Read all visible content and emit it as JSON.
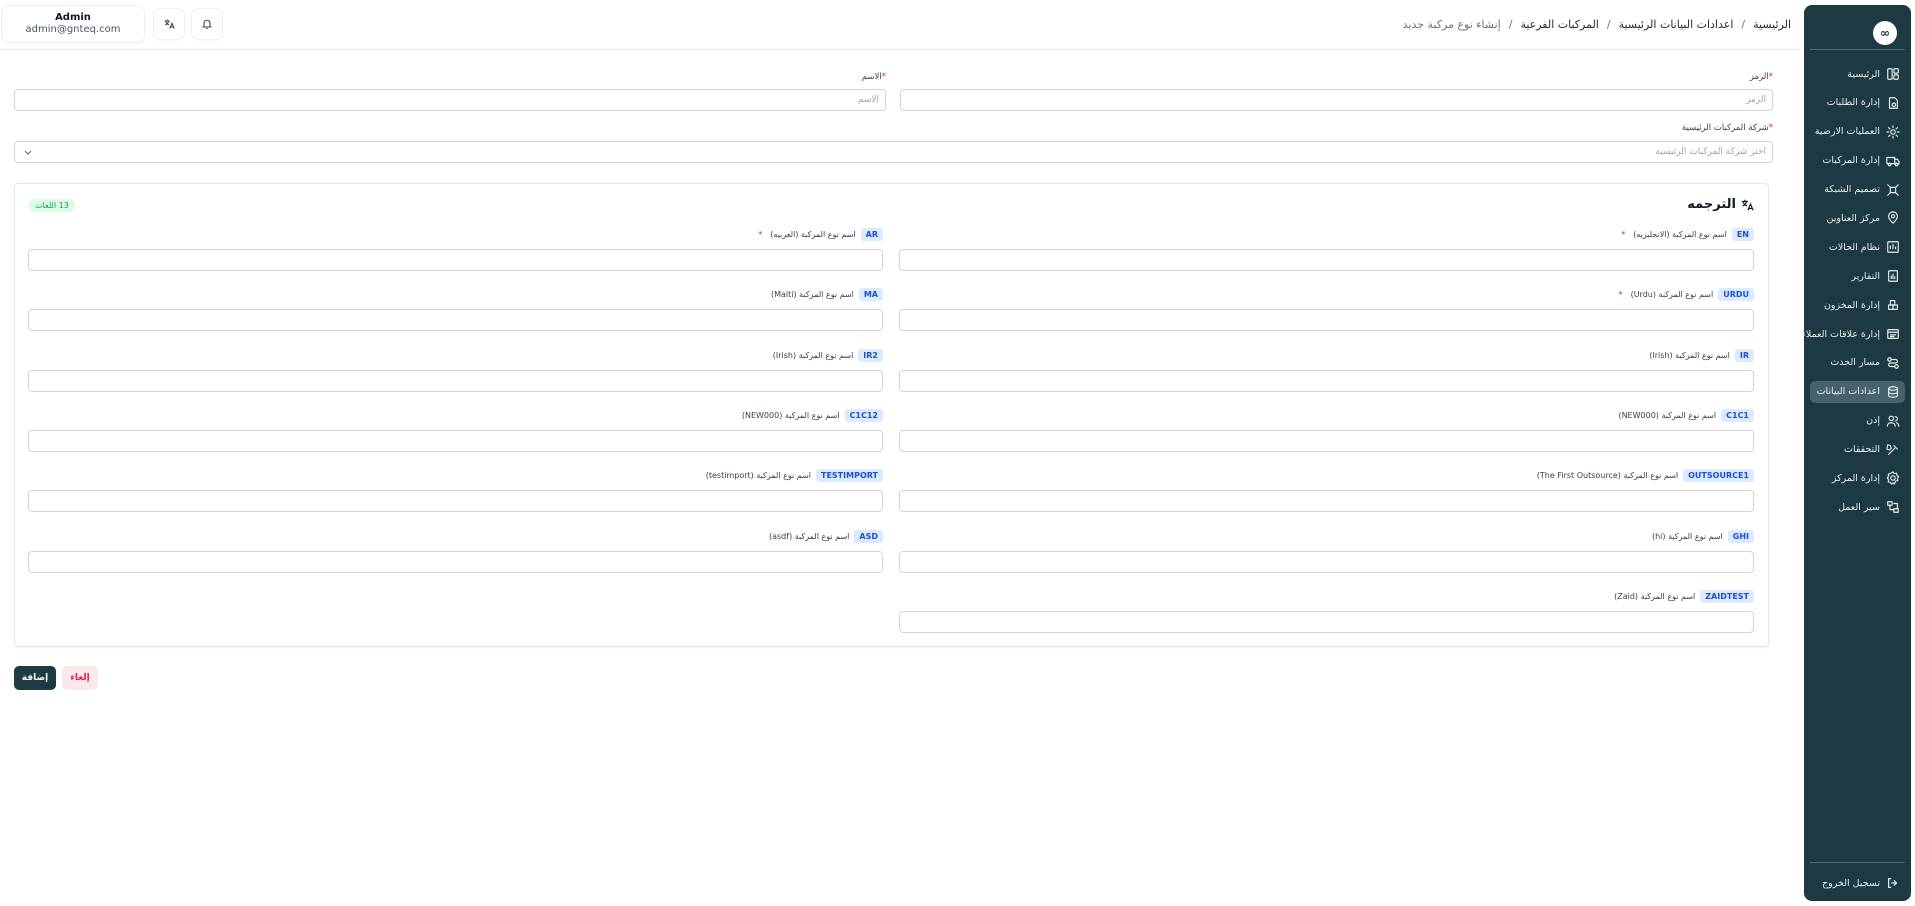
{
  "breadcrumb": [
    "الرئيسية",
    "اعدادات البيانات الرئيسية",
    "المركبات الفرعية"
  ],
  "breadcrumb_current": "إنشاء نوع مركبة جديد",
  "user": {
    "name": "Admin",
    "email": "admin@gnteq.com"
  },
  "header_icons": [
    "translate-icon",
    "bell-icon"
  ],
  "sidebar": {
    "logo": "∞",
    "items": [
      {
        "label": "الرئيسية",
        "icon": "home-icon"
      },
      {
        "label": "إدارة الطلبات",
        "icon": "orders-icon"
      },
      {
        "label": "العمليات الارضية",
        "icon": "ground-ops-icon"
      },
      {
        "label": "إدارة المركبات",
        "icon": "truck-icon"
      },
      {
        "label": "تصميم الشبكة",
        "icon": "network-icon"
      },
      {
        "label": "مركز العناوين",
        "icon": "location-icon"
      },
      {
        "label": "نظام الحالات",
        "icon": "status-icon"
      },
      {
        "label": "التقارير",
        "icon": "reports-icon"
      },
      {
        "label": "إدارة المخزون",
        "icon": "inventory-icon"
      },
      {
        "label": "إدارة علاقات العملاء",
        "icon": "crm-icon"
      },
      {
        "label": "مسار الحدث",
        "icon": "route-icon"
      },
      {
        "label": "اعدادات البيانات",
        "icon": "database-icon",
        "active": true
      },
      {
        "label": "إذن",
        "icon": "users-icon"
      },
      {
        "label": "التحققات",
        "icon": "tools-icon"
      },
      {
        "label": "إدارة المركز",
        "icon": "settings-icon"
      },
      {
        "label": "سير العمل",
        "icon": "workflow-icon"
      }
    ],
    "logout": "تسجيل الخروج"
  },
  "form": {
    "code_label": "الرمز",
    "code_placeholder": "الرمز",
    "name_label": "الاسم",
    "name_placeholder": "الاسم",
    "company_label": "شركة المركبات الرئيسية",
    "company_placeholder": "اختر شركة المركبات الرئيسية"
  },
  "translation": {
    "title": "الترجمه",
    "count_badge": "13 اللغات",
    "fields": [
      {
        "code": "EN",
        "label": "اسم نوع المركبة (الانجليزيه)",
        "required": true
      },
      {
        "code": "AR",
        "label": "اسم نوع المركبة (العربيه)",
        "required": true
      },
      {
        "code": "URDU",
        "label": "اسم نوع المركبة (Urdu)",
        "required": true
      },
      {
        "code": "MA",
        "label": "اسم نوع المركبة (Malti)",
        "required": false
      },
      {
        "code": "IR",
        "label": "اسم نوع المركبة (Irish)",
        "required": false
      },
      {
        "code": "IR2",
        "label": "اسم نوع المركبة (Irish)",
        "required": false
      },
      {
        "code": "C1C1",
        "label": "اسم نوع المركبة (NEW000)",
        "required": false
      },
      {
        "code": "C1C12",
        "label": "اسم نوع المركبة (NEW000)",
        "required": false
      },
      {
        "code": "OUTSOURCE1",
        "label": "اسم نوع المركبة (The First Outsource)",
        "required": false
      },
      {
        "code": "TESTIMPORT",
        "label": "اسم نوع المركبة (testimport)",
        "required": false
      },
      {
        "code": "GHI",
        "label": "اسم نوع المركبة (hi)",
        "required": false
      },
      {
        "code": "ASD",
        "label": "اسم نوع المركبة (asdf)",
        "required": false
      },
      {
        "code": "ZAIDTEST",
        "label": "اسم نوع المركبة (Zaid)",
        "required": false
      }
    ]
  },
  "actions": {
    "add": "إضافة",
    "cancel": "إلغاء"
  }
}
